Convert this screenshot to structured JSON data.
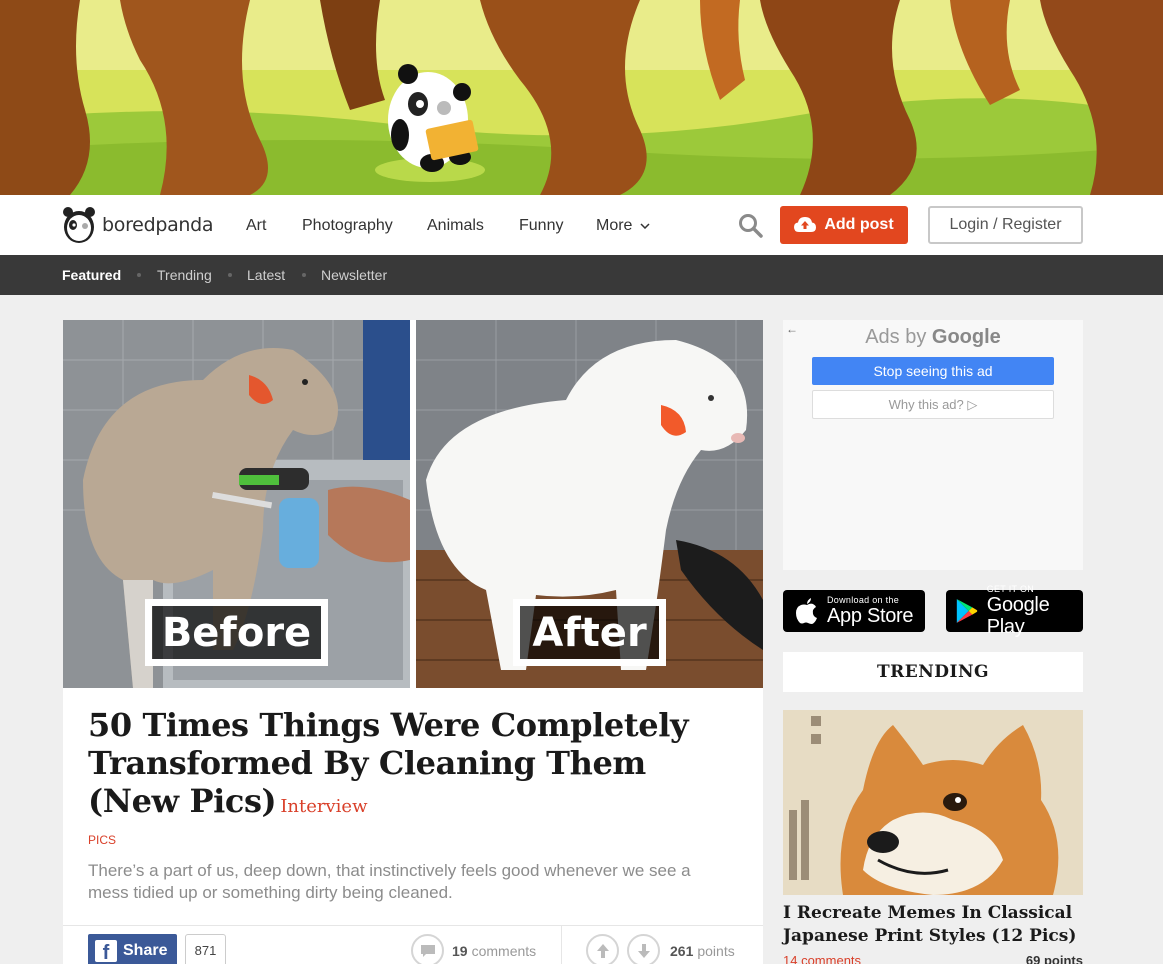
{
  "brand": {
    "name": "boredpanda"
  },
  "nav": {
    "links": [
      "Art",
      "Photography",
      "Animals",
      "Funny"
    ],
    "more_label": "More",
    "add_post_label": "Add post",
    "login_label": "Login / Register"
  },
  "subnav": {
    "items": [
      "Featured",
      "Trending",
      "Latest",
      "Newsletter"
    ],
    "active": "Featured"
  },
  "article": {
    "before_label": "Before",
    "after_label": "After",
    "title": "50 Times Things Were Completely Transformed By Cleaning Them (New Pics)",
    "badge": "Interview",
    "category": "PICS",
    "description": "There’s a part of us, deep down, that instinctively feels good whenever we see a mess tidied up or something dirty being cleaned.",
    "share_label": "Share",
    "share_count": "871",
    "comments_count": "19",
    "comments_label": "comments",
    "points_count": "261",
    "points_label": "points"
  },
  "ad": {
    "ads_by": "Ads by",
    "google": "Google",
    "stop_label": "Stop seeing this ad",
    "why_label": "Why this ad? ▷"
  },
  "stores": {
    "apple_small": "Download on the",
    "apple_big": "App Store",
    "google_small": "GET IT ON",
    "google_big": "Google Play"
  },
  "trending": {
    "heading": "TRENDING",
    "item_title": "I Recreate Memes In Classical Japanese Print Styles (12 Pics)",
    "item_comments": "14 comments",
    "item_points": "69 points"
  },
  "colors": {
    "accent": "#e2471f",
    "link_red": "#d9402a",
    "subnav_bg": "#393939",
    "facebook": "#3b5998",
    "google_blue": "#4285f4"
  }
}
